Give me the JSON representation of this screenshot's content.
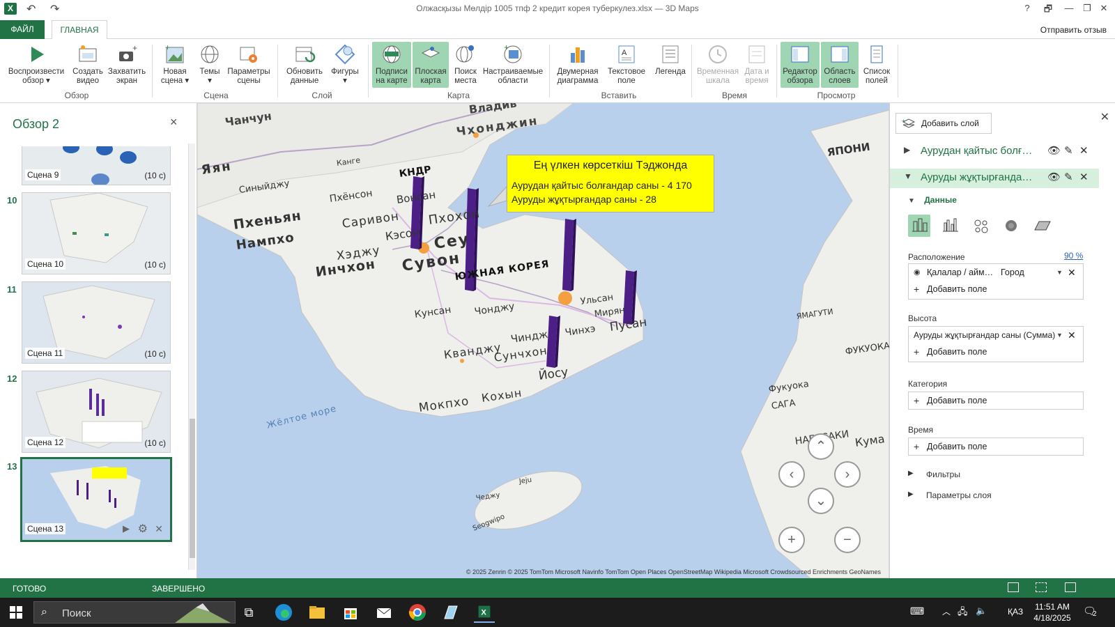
{
  "titlebar": {
    "title": "Олжасқызы Мөлдір 1005 тпф 2 кредит корея туберкулез.xlsx — 3D Maps",
    "help": "?",
    "restore": "🗗",
    "minimize": "—",
    "maximize": "❐",
    "close": "✕"
  },
  "tabs": {
    "file": "ФАЙЛ",
    "home": "ГЛАВНАЯ",
    "feedback": "Отправить отзыв"
  },
  "ribbon": {
    "buttons": [
      {
        "l1": "Воспроизвести",
        "l2": "обзор ▾"
      },
      {
        "l1": "Создать",
        "l2": "видео"
      },
      {
        "l1": "Захватить",
        "l2": "экран"
      },
      {
        "l1": "Новая",
        "l2": "сцена ▾"
      },
      {
        "l1": "Темы",
        "l2": "▾"
      },
      {
        "l1": "Параметры",
        "l2": "сцены"
      },
      {
        "l1": "Обновить",
        "l2": "данные"
      },
      {
        "l1": "Фигуры",
        "l2": "▾"
      },
      {
        "l1": "Подписи",
        "l2": "на карте"
      },
      {
        "l1": "Плоская",
        "l2": "карта"
      },
      {
        "l1": "Поиск",
        "l2": "места"
      },
      {
        "l1": "Настраиваемые",
        "l2": "области"
      },
      {
        "l1": "Двумерная",
        "l2": "диаграмма"
      },
      {
        "l1": "Текстовое",
        "l2": "поле"
      },
      {
        "l1": "Легенда",
        "l2": ""
      },
      {
        "l1": "Временная",
        "l2": "шкала"
      },
      {
        "l1": "Дата и",
        "l2": "время"
      },
      {
        "l1": "Редактор",
        "l2": "обзора"
      },
      {
        "l1": "Область",
        "l2": "слоев"
      },
      {
        "l1": "Список",
        "l2": "полей"
      }
    ],
    "groups": [
      "Обзор",
      "Сцена",
      "Слой",
      "Карта",
      "Вставить",
      "Время",
      "Просмотр"
    ]
  },
  "tour": {
    "title": "Обзор 2",
    "close": "×",
    "scenes": [
      {
        "num": "",
        "label": "Сцена 9",
        "dur": "(10 с)"
      },
      {
        "num": "10",
        "label": "Сцена 10",
        "dur": "(10 с)"
      },
      {
        "num": "11",
        "label": "Сцена 11",
        "dur": "(10 с)"
      },
      {
        "num": "12",
        "label": "Сцена 12",
        "dur": "(10 с)"
      },
      {
        "num": "13",
        "label": "Сцена 13",
        "dur": ""
      }
    ]
  },
  "map": {
    "labels": {
      "vladivostok": "Владив",
      "chanchun": "Чанчун",
      "chkhonjin": "Чхонджин",
      "yan": "Яян",
      "kange": "Канге",
      "kndr": "КНДР",
      "sinyidzhu": "Синыйджу",
      "pkhenson": "Пхёнсон",
      "vonsan": "Вонсан",
      "pkhenyan": "Пхеньян",
      "sarivon": "Саривон",
      "kesson": "Кэсон",
      "pkhohon": "Пхохон",
      "nampkho": "Нампхо",
      "khedzhu": "Хэджу",
      "seul": "Сеу",
      "inchkhon": "Инчхон",
      "suvon": "Сувон",
      "south_korea": "ЮЖНАЯ КОРЕЯ",
      "kunsan": "Кунсан",
      "chondzhu": "Чонджу",
      "ulsan": "Ульсан",
      "miryan": "Мирян",
      "pusan": "Пусан",
      "kvandzhu": "Кванджу",
      "chindzhu": "Чиндж",
      "sunchkhon": "Сунчхон",
      "chinge": "Чинхэ",
      "yosu": "Йосу",
      "mokpkho": "Мокпхо",
      "kokhyn": "Кохын",
      "yellow_sea": "Жёлтое море",
      "cheju": "Чеджу",
      "jeju": "Jeju",
      "seogwipo": "Seogwipo",
      "japan": "ЯПОНИ",
      "fukuoka": "Фукуока",
      "saga": "САГА",
      "nagasaki": "НАГАСАКИ",
      "kumamoto": "Кума",
      "yamaguchi": "ЯМАГУТИ",
      "fukuoka2": "ФУКУОКА"
    },
    "tooltip": {
      "title": "Ең үлкен көрсеткіш Тэджонда",
      "line1": "Аурудан қайтыс болғандар саны - 4 170",
      "line2": "Ауруды жұқтырғандар саны - 28"
    },
    "copyright": "© 2025 Zenrin  © 2025 TomTom  Microsoft  Navinfo  TomTom  Open Places  OpenStreetMap  Wikipedia  Microsoft Crowdsourced Enrichments  GeoNames",
    "bar_color": "#4b1f86"
  },
  "pane": {
    "add_layer": "Добавить слой",
    "layer1": "Аурудан қайтыс болғандар саны",
    "layer2": "Ауруды жұқтырғандар саны",
    "data_section": "Данные",
    "location_label": "Расположение",
    "location_pct": "90 %",
    "location_field": "Қалалар / аймақтар",
    "location_type": "Город",
    "add_field": "Добавить поле",
    "height_label": "Высота",
    "height_field": "Ауруды жұқтырғандар саны (Сумма)",
    "category_label": "Категория",
    "time_label": "Время",
    "filters": "Фильтры",
    "layer_params": "Параметры слоя"
  },
  "status": {
    "ready": "ГОТОВО",
    "done": "ЗАВЕРШЕНО"
  },
  "taskbar": {
    "search": "Поиск",
    "lang": "ҚАЗ",
    "time": "11:51 AM",
    "date": "4/18/2025",
    "notifications": "2"
  }
}
